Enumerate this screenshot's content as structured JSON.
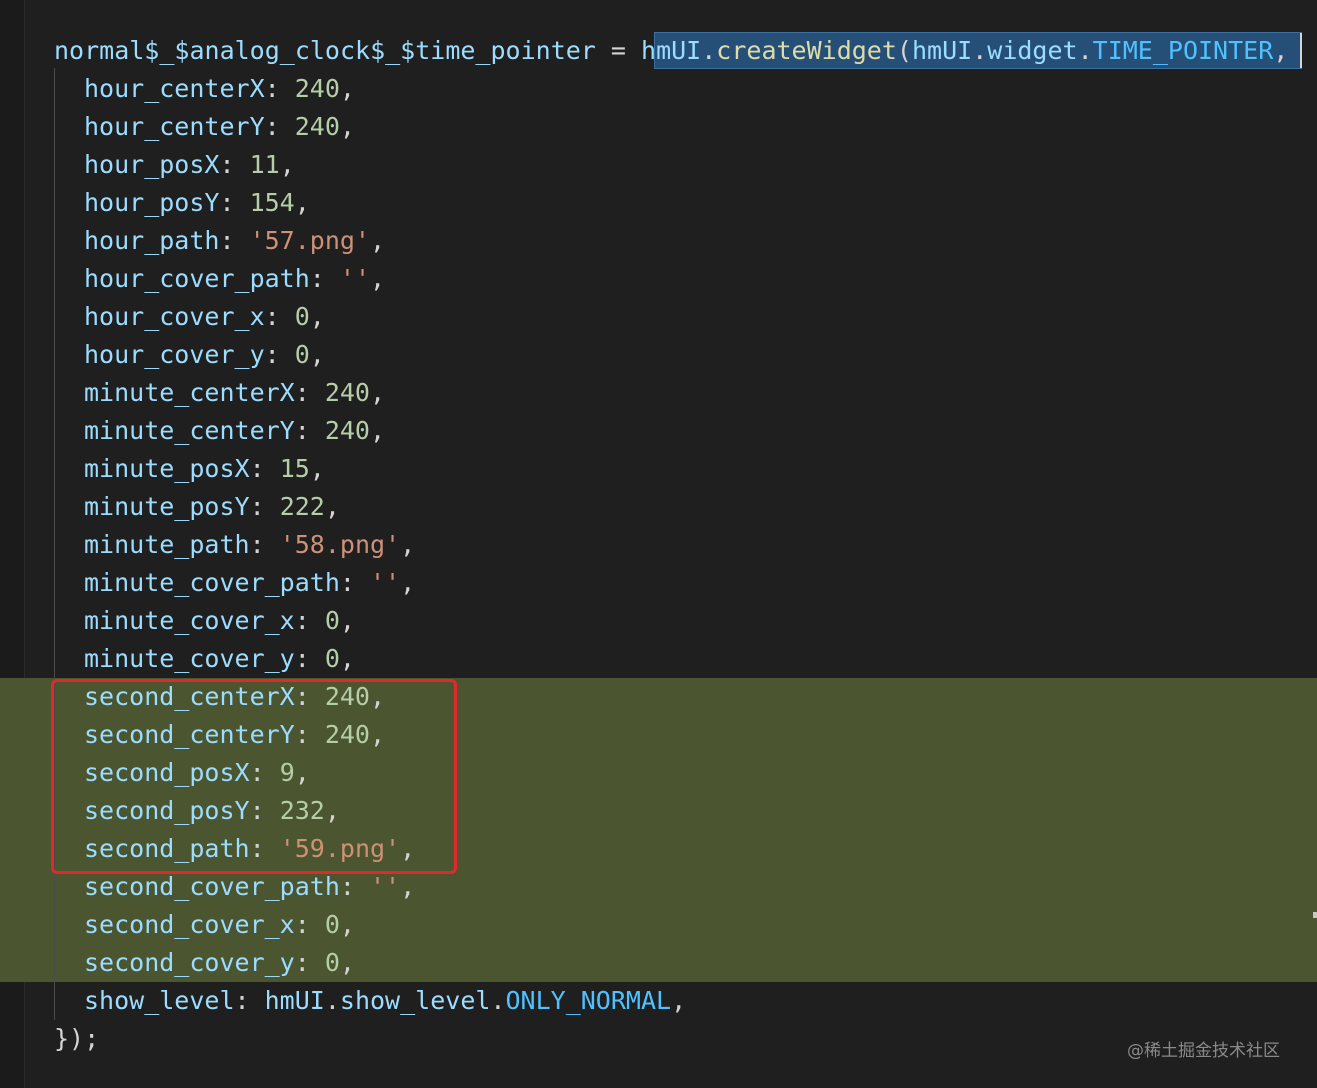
{
  "header_line": {
    "var_name": "normal$_$analog_clock$_$time_pointer",
    "eq": " = ",
    "obj": "hmUI",
    "dot1": ".",
    "method": "createWidget",
    "paren": "(",
    "obj2": "hmUI",
    "dot2": ".",
    "prop": "widget",
    "dot3": ".",
    "const": "TIME_POINTER",
    "comma": ","
  },
  "properties": [
    {
      "key": "hour_centerX",
      "value": "240",
      "type": "number"
    },
    {
      "key": "hour_centerY",
      "value": "240",
      "type": "number"
    },
    {
      "key": "hour_posX",
      "value": "11",
      "type": "number"
    },
    {
      "key": "hour_posY",
      "value": "154",
      "type": "number"
    },
    {
      "key": "hour_path",
      "value": "'57.png'",
      "type": "string"
    },
    {
      "key": "hour_cover_path",
      "value": "''",
      "type": "string"
    },
    {
      "key": "hour_cover_x",
      "value": "0",
      "type": "number"
    },
    {
      "key": "hour_cover_y",
      "value": "0",
      "type": "number"
    },
    {
      "key": "minute_centerX",
      "value": "240",
      "type": "number"
    },
    {
      "key": "minute_centerY",
      "value": "240",
      "type": "number"
    },
    {
      "key": "minute_posX",
      "value": "15",
      "type": "number"
    },
    {
      "key": "minute_posY",
      "value": "222",
      "type": "number"
    },
    {
      "key": "minute_path",
      "value": "'58.png'",
      "type": "string"
    },
    {
      "key": "minute_cover_path",
      "value": "''",
      "type": "string"
    },
    {
      "key": "minute_cover_x",
      "value": "0",
      "type": "number"
    },
    {
      "key": "minute_cover_y",
      "value": "0",
      "type": "number"
    },
    {
      "key": "second_centerX",
      "value": "240",
      "type": "number"
    },
    {
      "key": "second_centerY",
      "value": "240",
      "type": "number"
    },
    {
      "key": "second_posX",
      "value": "9",
      "type": "number"
    },
    {
      "key": "second_posY",
      "value": "232",
      "type": "number"
    },
    {
      "key": "second_path",
      "value": "'59.png'",
      "type": "string"
    },
    {
      "key": "second_cover_path",
      "value": "''",
      "type": "string"
    },
    {
      "key": "second_cover_x",
      "value": "0",
      "type": "number"
    },
    {
      "key": "second_cover_y",
      "value": "0",
      "type": "number"
    }
  ],
  "show_level_line": {
    "key": "show_level",
    "sep": ": ",
    "obj": "hmUI",
    "dot1": ".",
    "prop": "show_level",
    "dot2": ".",
    "const": "ONLY_NORMAL",
    "comma": ","
  },
  "closing_line": "});",
  "watermark": "@稀土掘金技术社区",
  "colors": {
    "background": "#1f1f1f",
    "highlight": "#4b5631",
    "selection": "#264f78",
    "red_box": "#e02a2a",
    "property": "#9cdcfe",
    "number": "#b5cea8",
    "string": "#ce9178",
    "constant": "#4fc1ff",
    "function": "#dcdcaa"
  }
}
